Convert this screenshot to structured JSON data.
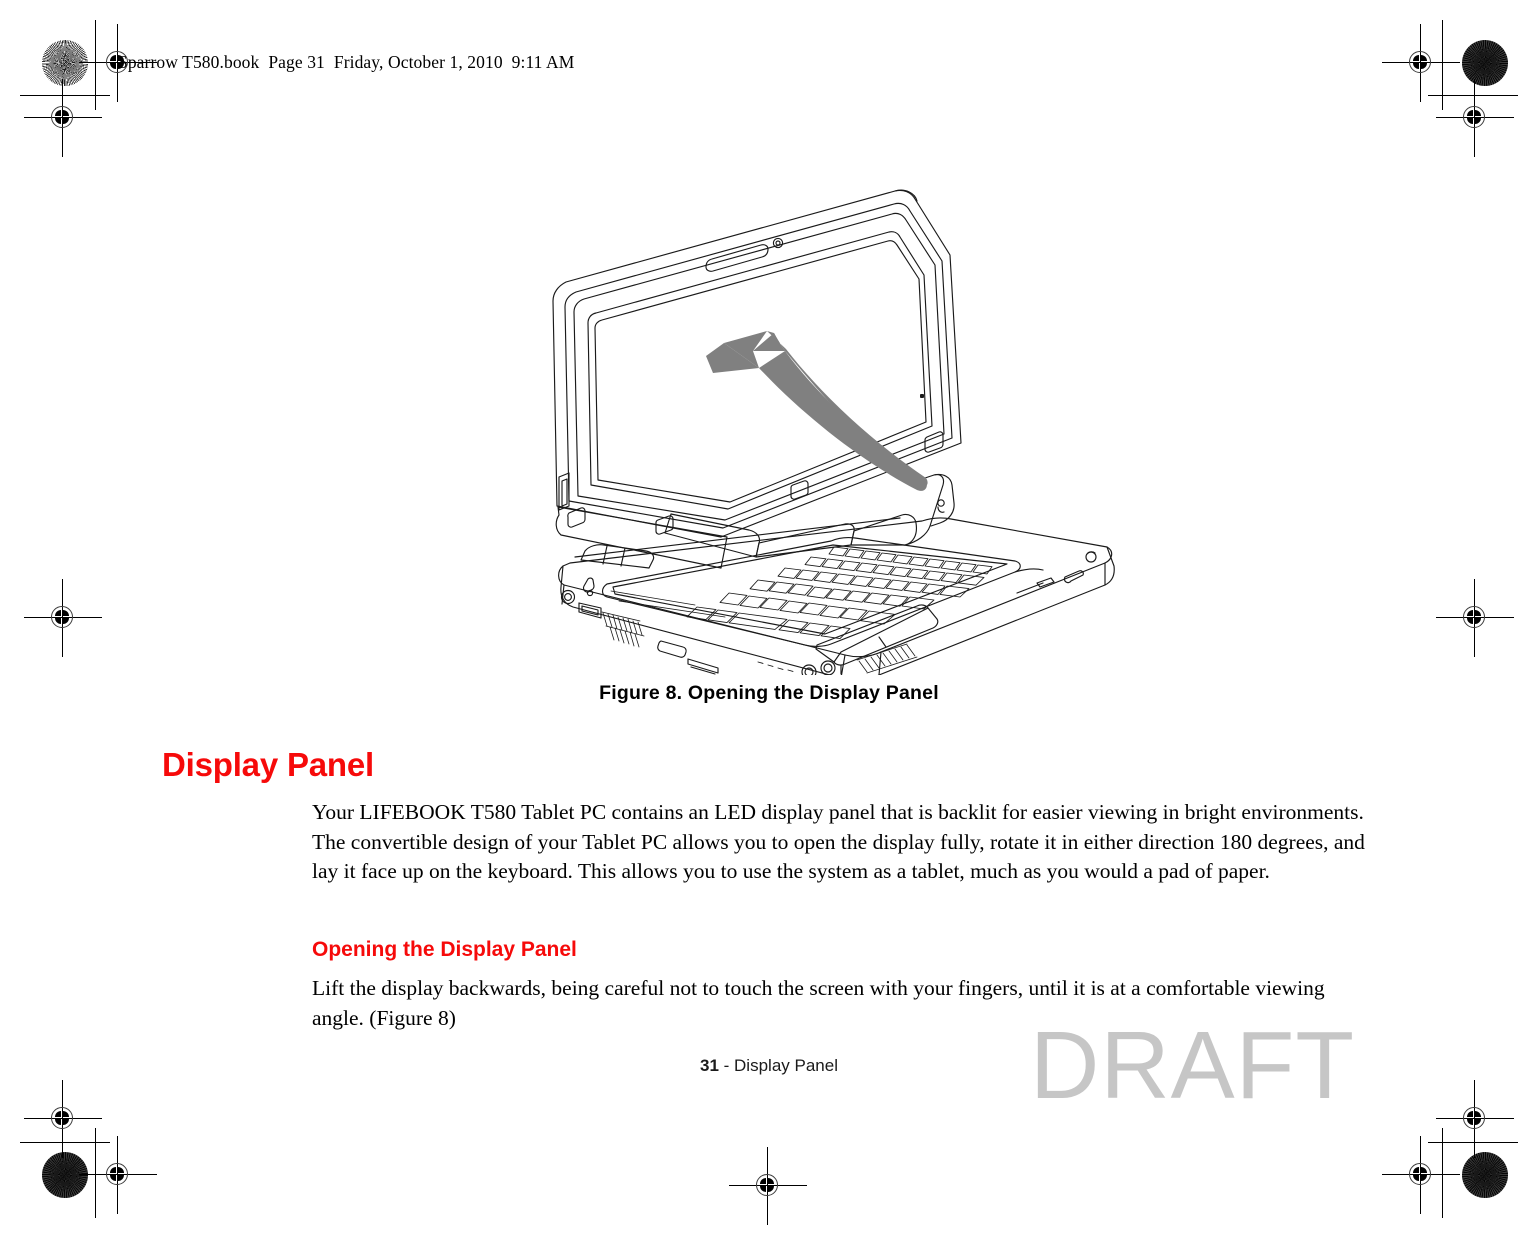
{
  "header": {
    "book_line": "Sparrow T580.book  Page 31  Friday, October 1, 2010  9:11 AM"
  },
  "figure": {
    "caption": "Figure 8.  Opening the Display Panel",
    "alt_name": "laptop-opening-display-illustration",
    "arrow_color": "#808080",
    "line_color": "#1a1a1a"
  },
  "content": {
    "heading": "Display Panel",
    "intro_paragraph": "Your LIFEBOOK T580 Tablet PC contains an LED display panel that is backlit for easier viewing in bright environments. The convertible design of your Tablet PC allows you to open the display fully, rotate it in either direction 180 degrees, and lay it face up on the keyboard. This allows you to use the system as a tablet, much as you would a pad of paper.",
    "subheading": "Opening the Display Panel",
    "opening_paragraph": "Lift the display backwards, being careful not to touch the screen with your fingers, until it is at a comfortable viewing angle. (Figure 8)",
    "heading_color": "#f60a0a"
  },
  "footer": {
    "page_number": "31",
    "page_label": " - Display Panel",
    "watermark": "DRAFT",
    "watermark_color": "#c6c6c6"
  }
}
